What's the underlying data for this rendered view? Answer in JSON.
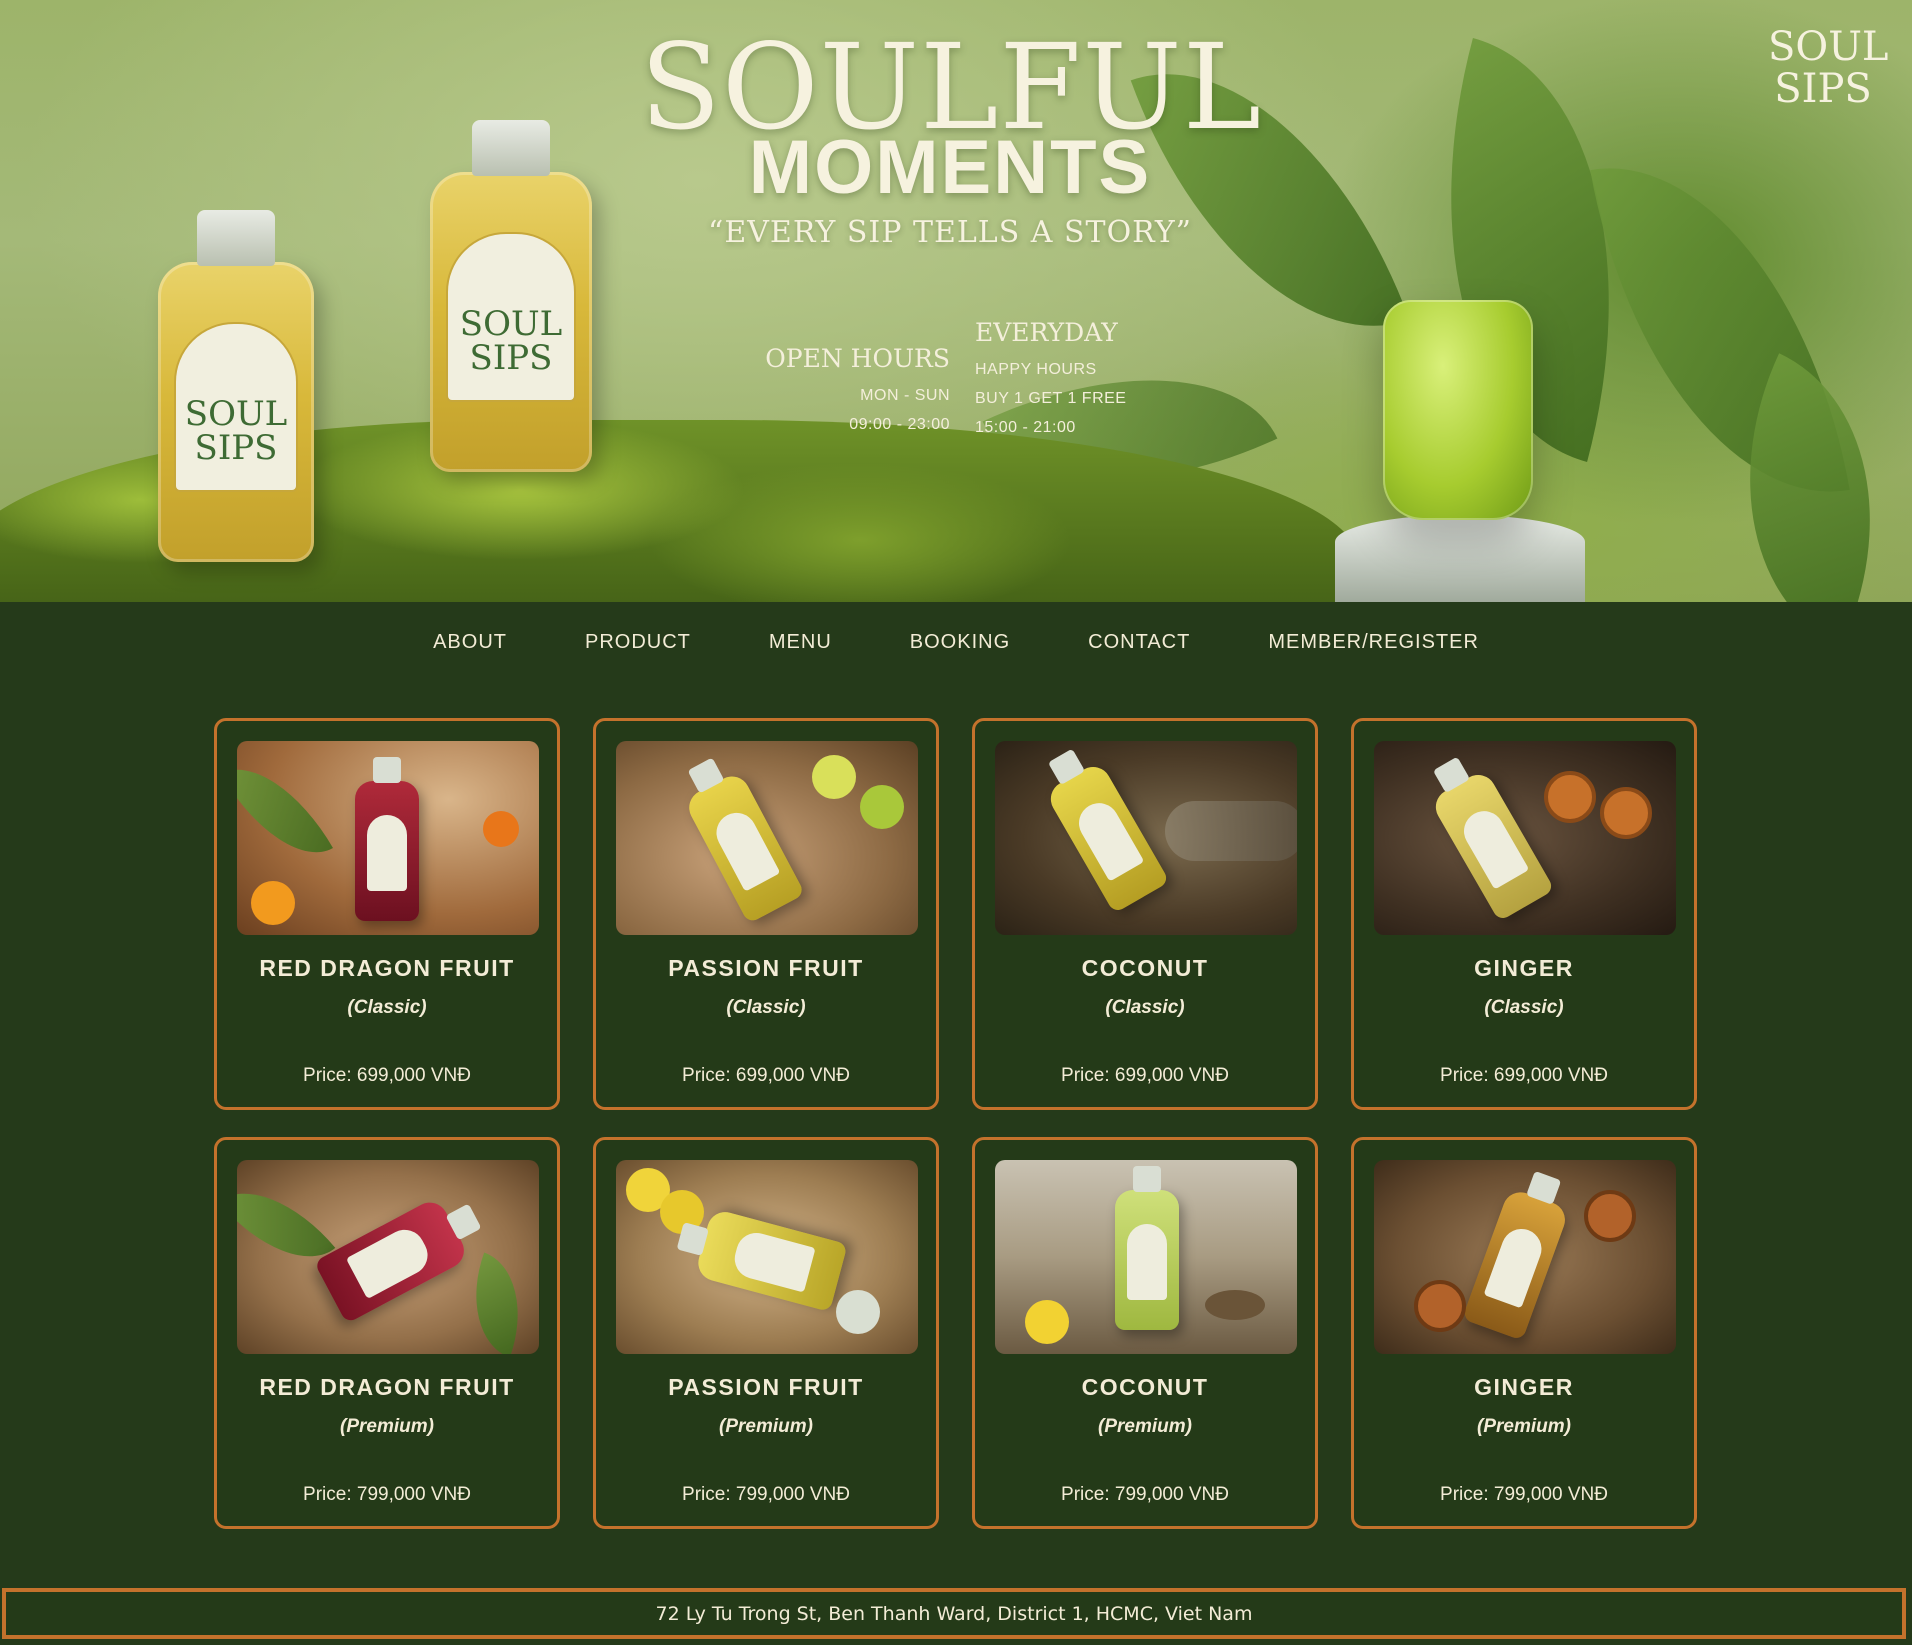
{
  "hero": {
    "title_line1": "SOULFUL",
    "title_line2": "MOMENTS",
    "tagline": "“EVERY SIP TELLS A STORY”",
    "brand_logo": "SOUL SIPS",
    "bottle_label": "SOUL SIPS",
    "open_hours": {
      "heading": "OPEN HOURS",
      "days": "MON - SUN",
      "time": "09:00 - 23:00"
    },
    "everyday": {
      "heading": "EVERYDAY",
      "label": "HAPPY HOURS",
      "offer": "BUY 1 GET 1 FREE",
      "time": "15:00 - 21:00"
    }
  },
  "nav": {
    "items": [
      "ABOUT",
      "PRODUCT",
      "MENU",
      "BOOKING",
      "CONTACT",
      "MEMBER/REGISTER"
    ]
  },
  "products": [
    {
      "name": "RED DRAGON FRUIT",
      "variant": "(Classic)",
      "price": "Price: 699,000 VNĐ"
    },
    {
      "name": "PASSION FRUIT",
      "variant": "(Classic)",
      "price": "Price: 699,000 VNĐ"
    },
    {
      "name": "COCONUT",
      "variant": "(Classic)",
      "price": "Price: 699,000 VNĐ"
    },
    {
      "name": "GINGER",
      "variant": "(Classic)",
      "price": "Price: 699,000 VNĐ"
    },
    {
      "name": "RED DRAGON FRUIT",
      "variant": "(Premium)",
      "price": "Price: 799,000 VNĐ"
    },
    {
      "name": "PASSION FRUIT",
      "variant": "(Premium)",
      "price": "Price: 799,000 VNĐ"
    },
    {
      "name": "COCONUT",
      "variant": "(Premium)",
      "price": "Price: 799,000 VNĐ"
    },
    {
      "name": "GINGER",
      "variant": "(Premium)",
      "price": "Price: 799,000 VNĐ"
    }
  ],
  "footer": {
    "address": "72 Ly Tu Trong St, Ben Thanh Ward, District 1, HCMC, Viet Nam"
  },
  "colors": {
    "background": "#253a1a",
    "accent_border": "#c4722c",
    "text": "#f3ecd6"
  }
}
